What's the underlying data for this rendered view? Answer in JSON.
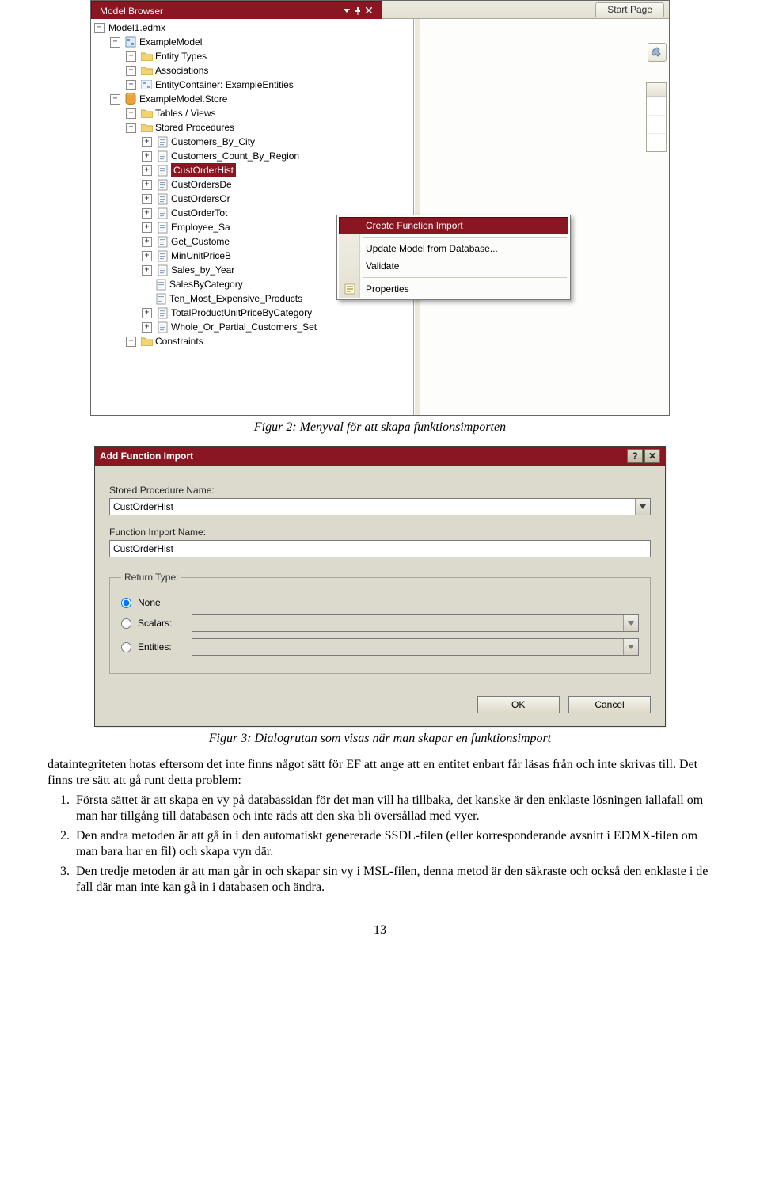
{
  "figure1": {
    "panel_title": "Model Browser",
    "tab_start": "Start Page",
    "tree": {
      "root": "Model1.edmx",
      "example_model": "ExampleModel",
      "entity_types": "Entity Types",
      "associations": "Associations",
      "entity_container": "EntityContainer: ExampleEntities",
      "store": "ExampleModel.Store",
      "tables_views": "Tables / Views",
      "stored_procs": "Stored Procedures",
      "sp": [
        "Customers_By_City",
        "Customers_Count_By_Region",
        "CustOrderHist",
        "CustOrdersDe",
        "CustOrdersOr",
        "CustOrderTot",
        "Employee_Sa",
        "Get_Custome",
        "MinUnitPriceB",
        "Sales_by_Year",
        "SalesByCategory",
        "Ten_Most_Expensive_Products",
        "TotalProductUnitPriceByCategory",
        "Whole_Or_Partial_Customers_Set"
      ],
      "constraints": "Constraints"
    },
    "context_menu": {
      "create_fi": "Create Function Import",
      "update": "Update Model from Database...",
      "validate": "Validate",
      "properties": "Properties"
    }
  },
  "caption1": "Figur 2: Menyval för att skapa funktionsimporten",
  "figure2": {
    "title": "Add Function Import",
    "label_sp": "Stored Procedure Name:",
    "value_sp": "CustOrderHist",
    "label_fi": "Function Import Name:",
    "value_fi": "CustOrderHist",
    "return_legend": "Return Type:",
    "opt_none": "None",
    "opt_scalars": "Scalars:",
    "opt_entities": "Entities:",
    "btn_ok": "OK",
    "btn_cancel": "Cancel"
  },
  "caption2": "Figur 3: Dialogrutan som visas när man skapar en funktionsimport",
  "body": {
    "para": "dataintegriteten hotas eftersom det inte finns något sätt för EF att ange att en entitet enbart får läsas från och inte skrivas till. Det finns tre sätt att gå runt detta problem:",
    "li1": "Första sättet är att skapa en vy på databassidan för det man vill ha tillbaka, det kanske är den enklaste lösningen iallafall om man har tillgång till databasen och inte räds att den ska bli översållad med vyer.",
    "li2": "Den andra metoden är att gå in i den automatiskt genererade SSDL-filen (eller korresponderande avsnitt i EDMX-filen om man bara har en fil) och skapa vyn där.",
    "li3": "Den tredje metoden är att man går in och skapar sin vy i MSL-filen, denna metod är den säkraste och också den enklaste i de fall där man inte kan gå in i databasen och ändra."
  },
  "page_number": "13"
}
